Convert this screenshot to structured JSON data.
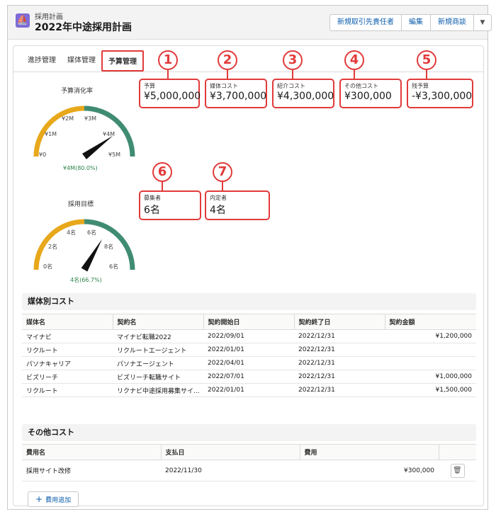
{
  "header": {
    "object_type": "採用計画",
    "title": "2022年中途採用計画",
    "buttons": [
      "新規取引先責任者",
      "編集",
      "新規商談"
    ],
    "dropdown_icon": "chevron-down-icon"
  },
  "tabs": [
    "進捗管理",
    "媒体管理",
    "予算管理"
  ],
  "active_tab": "予算管理",
  "budget_gauge": {
    "title": "予算消化率",
    "labels": [
      "¥0",
      "¥1M",
      "¥2M",
      "¥3M",
      "¥4M",
      "¥5M"
    ],
    "value_text": "¥4M(80.0%)",
    "percent": 0.8,
    "colors": {
      "low": "#e8a81b",
      "high": "#3f8c73",
      "needle": "#111111"
    }
  },
  "hire_gauge": {
    "title": "採用目標",
    "labels": [
      "0名",
      "2名",
      "4名",
      "6名",
      "8名",
      "6名"
    ],
    "value_text": "4名(66.7%)",
    "percent": 0.667
  },
  "metrics": [
    {
      "num": "1",
      "label": "予算",
      "value": "¥5,000,000"
    },
    {
      "num": "2",
      "label": "媒体コスト",
      "value": "¥3,700,000"
    },
    {
      "num": "3",
      "label": "紹介コスト",
      "value": "¥4,300,000"
    },
    {
      "num": "4",
      "label": "その他コスト",
      "value": "¥300,000"
    },
    {
      "num": "5",
      "label": "残予算",
      "value": "-¥3,300,000"
    },
    {
      "num": "6",
      "label": "募集者",
      "value": "6名"
    },
    {
      "num": "7",
      "label": "内定者",
      "value": "4名"
    }
  ],
  "media_costs": {
    "title": "媒体別コスト",
    "columns": [
      "媒体名",
      "契約名",
      "契約開始日",
      "契約終了日",
      "契約金額"
    ],
    "rows": [
      [
        "マイナビ",
        "マイナビ転職2022",
        "2022/09/01",
        "2022/12/31",
        "¥1,200,000"
      ],
      [
        "リクルート",
        "リクルートエージェント",
        "2022/01/01",
        "2022/12/31",
        ""
      ],
      [
        "パソナキャリア",
        "パソナエージェント",
        "2022/04/01",
        "2022/12/31",
        ""
      ],
      [
        "ビズリーチ",
        "ビズリーチ転職サイト",
        "2022/07/01",
        "2022/12/31",
        "¥1,000,000"
      ],
      [
        "リクルート",
        "リクナビ中途採用募集サイ...",
        "2022/01/01",
        "2022/12/31",
        "¥1,500,000"
      ]
    ]
  },
  "other_costs": {
    "title": "その他コスト",
    "columns": [
      "費用名",
      "支払日",
      "費用"
    ],
    "rows": [
      [
        "採用サイト改修",
        "2022/11/30",
        "¥300,000"
      ]
    ],
    "add_label": "費用追加",
    "delete_icon": "trash-icon"
  },
  "accent_color": "#e23a3a"
}
